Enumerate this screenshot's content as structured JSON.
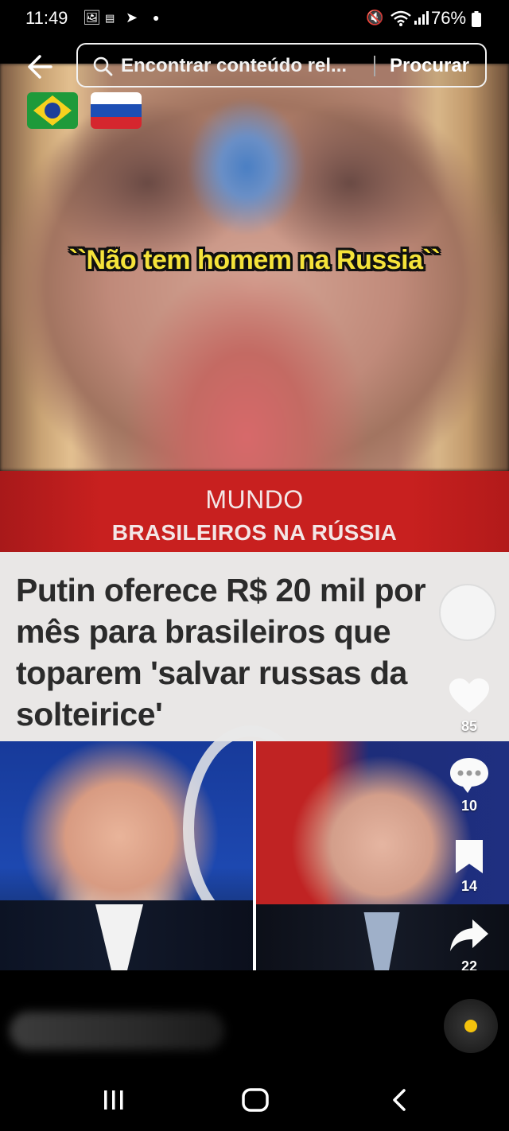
{
  "status_bar": {
    "time": "11:49",
    "battery": "76%"
  },
  "search": {
    "placeholder": "Encontrar conteúdo rel...",
    "submit_label": "Procurar"
  },
  "video": {
    "caption": "``Não tem homem na Russia``",
    "flags": [
      "brazil-flag",
      "russia-flag"
    ],
    "news": {
      "kicker": "MUNDO",
      "section": "BRASILEIROS NA RÚSSIA",
      "headline": "Putin oferece R$ 20 mil por mês para brasileiros que toparem 'salvar russas da solteirice'"
    }
  },
  "actions": {
    "likes": "85",
    "comments": "10",
    "saves": "14",
    "shares": "22"
  },
  "colors": {
    "caption_yellow": "#f5e33a",
    "banner_red": "#c8201f",
    "headline_bg": "#e9e7e6",
    "music_dot": "#f4c20d"
  }
}
